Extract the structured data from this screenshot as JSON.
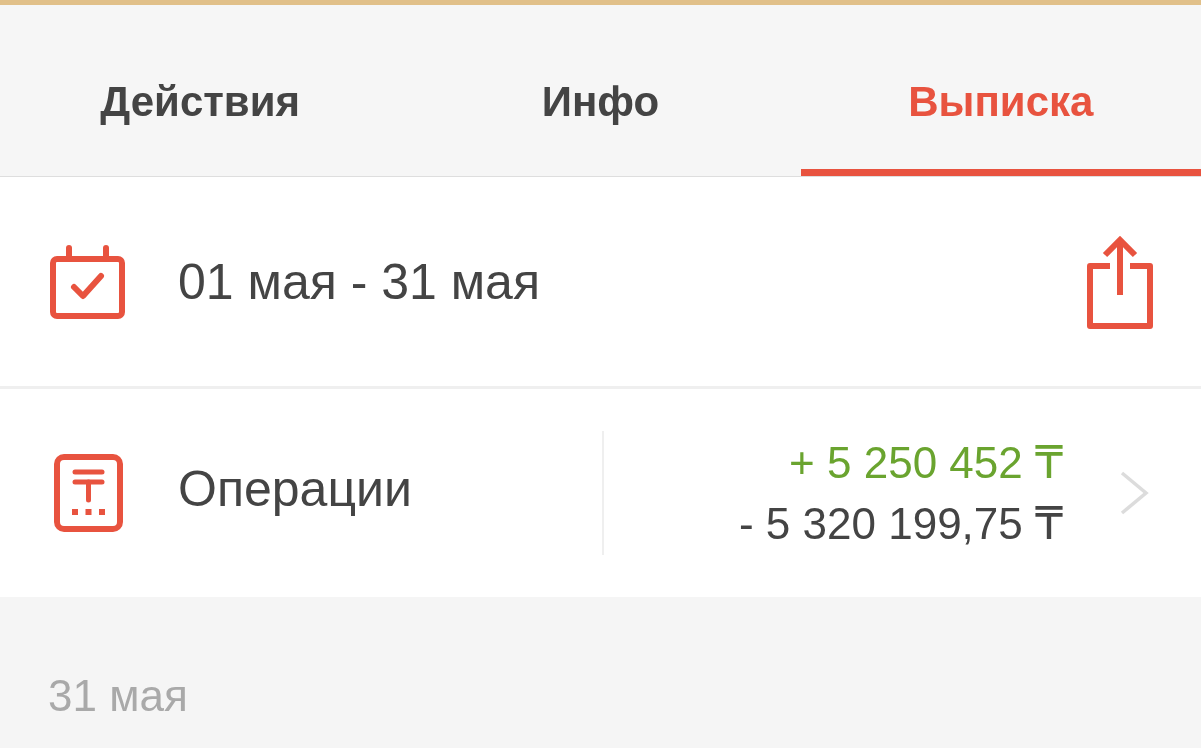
{
  "tabs": [
    {
      "label": "Действия",
      "selected": false
    },
    {
      "label": "Инфо",
      "selected": false
    },
    {
      "label": "Выписка",
      "selected": true
    }
  ],
  "period": {
    "label": "01 мая - 31 мая"
  },
  "operations": {
    "label": "Операции",
    "income": "+ 5 250 452 ₸",
    "expense": "- 5 320 199,75 ₸"
  },
  "day_header": "31 мая"
}
